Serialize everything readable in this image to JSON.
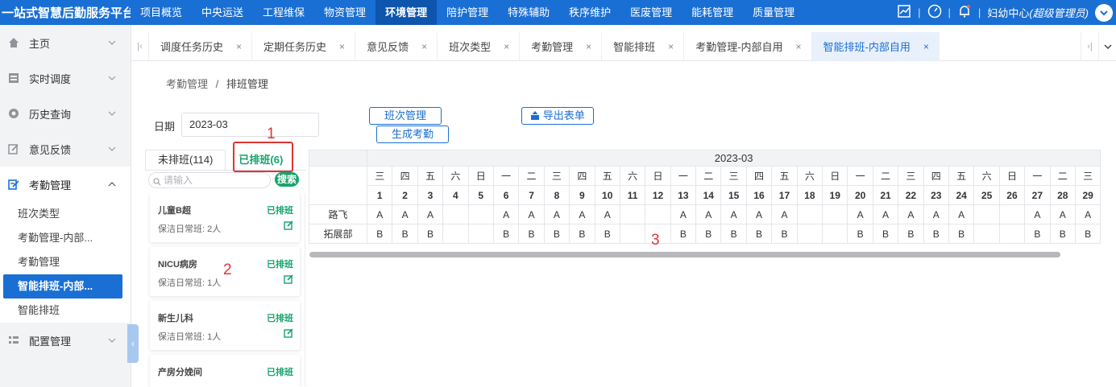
{
  "brand": "一站式智慧后勤服务平台",
  "top_nav": [
    "项目概览",
    "中央运送",
    "工程维保",
    "物资管理",
    "环境管理",
    "陪护管理",
    "特殊辅助",
    "秩序维护",
    "医废管理",
    "能耗管理",
    "质量管理"
  ],
  "top_nav_active": "环境管理",
  "user": {
    "org": "妇幼中心",
    "role": "(超级管理员)"
  },
  "sidebar": {
    "items": [
      {
        "label": "主页",
        "icon": "home-icon"
      },
      {
        "label": "实时调度",
        "icon": "dispatch-icon"
      },
      {
        "label": "历史查询",
        "icon": "history-icon"
      },
      {
        "label": "意见反馈",
        "icon": "feedback-icon"
      },
      {
        "label": "考勤管理",
        "icon": "attendance-icon"
      }
    ],
    "sub_items": [
      "班次类型",
      "考勤管理-内部...",
      "考勤管理",
      "智能排班-内部...",
      "智能排班"
    ],
    "sub_active": "智能排班-内部...",
    "bottom_item": {
      "label": "配置管理",
      "icon": "config-icon"
    }
  },
  "tabs": [
    "调度任务历史",
    "定期任务历史",
    "意见反馈",
    "班次类型",
    "考勤管理",
    "智能排班",
    "考勤管理-内部自用",
    "智能排班-内部自用"
  ],
  "tab_active": "智能排班-内部自用",
  "breadcrumb": {
    "parent": "考勤管理",
    "sep": "/",
    "current": "排班管理"
  },
  "filter": {
    "date_label": "日期",
    "date_value": "2023-03"
  },
  "buttons": {
    "shift": "班次管理",
    "generate": "生成考勤",
    "export": "导出表单"
  },
  "panel": {
    "tab_unscheduled": "未排班(114)",
    "tab_scheduled": "已排班(6)",
    "search_placeholder": "请输入",
    "search_button": "搜索",
    "cards": [
      {
        "name": "儿童B超",
        "status": "已排班",
        "desc": "保洁日常班: 2人"
      },
      {
        "name": "NICU病房",
        "status": "已排班",
        "desc": "保洁日常班: 1人"
      },
      {
        "name": "新生儿科",
        "status": "已排班",
        "desc": "保洁日常班: 1人"
      },
      {
        "name": "产房分娩间",
        "status": "已排班",
        "desc": ""
      }
    ]
  },
  "annotations": [
    "1",
    "2",
    "3"
  ],
  "schedule": {
    "month": "2023-03",
    "weekdays": [
      "三",
      "四",
      "五",
      "六",
      "日",
      "一",
      "二",
      "三",
      "四",
      "五",
      "六",
      "日",
      "一",
      "二",
      "三",
      "四",
      "五",
      "六",
      "日",
      "一",
      "二",
      "三",
      "四",
      "五",
      "六",
      "日",
      "一",
      "二",
      "三"
    ],
    "days": [
      "1",
      "2",
      "3",
      "4",
      "5",
      "6",
      "7",
      "8",
      "9",
      "10",
      "11",
      "12",
      "13",
      "14",
      "15",
      "16",
      "17",
      "18",
      "19",
      "20",
      "21",
      "22",
      "23",
      "24",
      "25",
      "26",
      "27",
      "28",
      "29"
    ],
    "rows": [
      {
        "name": "路飞",
        "cells": [
          "A",
          "A",
          "A",
          "",
          "",
          "A",
          "A",
          "A",
          "A",
          "A",
          "",
          "",
          "A",
          "A",
          "A",
          "A",
          "A",
          "",
          "",
          "A",
          "A",
          "A",
          "A",
          "A",
          "",
          "",
          "A",
          "A",
          "A"
        ]
      },
      {
        "name": "拓展部",
        "cells": [
          "B",
          "B",
          "B",
          "",
          "",
          "B",
          "B",
          "B",
          "B",
          "B",
          "",
          "",
          "B",
          "B",
          "B",
          "B",
          "B",
          "",
          "",
          "B",
          "B",
          "B",
          "B",
          "B",
          "",
          "",
          "B",
          "B",
          "B"
        ]
      }
    ]
  },
  "colors": {
    "primary": "#1a6fd4",
    "success": "#16a36b",
    "annotation": "#e23434"
  }
}
